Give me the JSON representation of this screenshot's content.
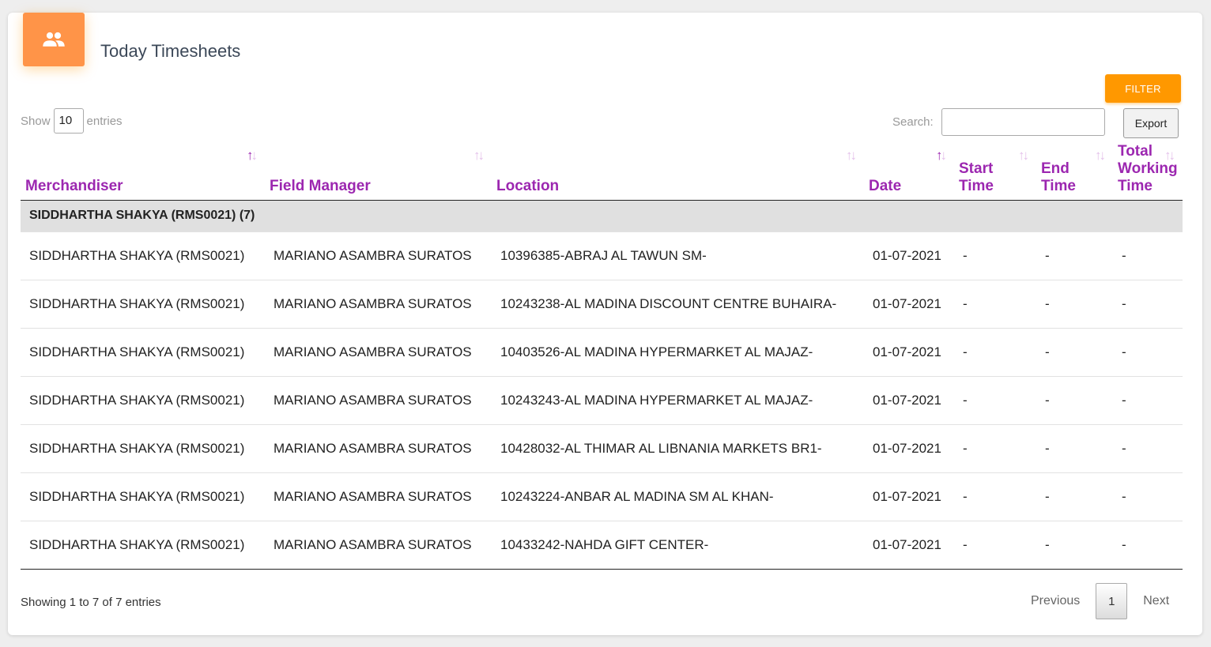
{
  "header": {
    "title": "Today Timesheets",
    "icon": "people-icon",
    "icon_color": "#ff9448"
  },
  "toolbar": {
    "filter_label": "FILTER",
    "show_label": "Show",
    "entries_count": "10",
    "entries_label": "entries",
    "search_label": "Search:",
    "search_value": "",
    "export_label": "Export"
  },
  "colors": {
    "accent": "#9c27b0",
    "filter": "#ff9800"
  },
  "table": {
    "columns": [
      {
        "label": "Merchandiser",
        "sort": "asc"
      },
      {
        "label": "Field Manager",
        "sort": "none"
      },
      {
        "label": "Location",
        "sort": "none"
      },
      {
        "label": "Date",
        "sort": "asc"
      },
      {
        "label": "Start Time",
        "sort": "none"
      },
      {
        "label": "End Time",
        "sort": "none"
      },
      {
        "label": "Total Working Time",
        "sort": "none"
      }
    ],
    "group_label": "SIDDHARTHA SHAKYA (RMS0021) (7)",
    "rows": [
      [
        "SIDDHARTHA SHAKYA (RMS0021)",
        "MARIANO ASAMBRA SURATOS",
        "10396385-ABRAJ AL TAWUN SM-",
        "01-07-2021",
        "-",
        "-",
        "-"
      ],
      [
        "SIDDHARTHA SHAKYA (RMS0021)",
        "MARIANO ASAMBRA SURATOS",
        "10243238-AL MADINA DISCOUNT CENTRE BUHAIRA-",
        "01-07-2021",
        "-",
        "-",
        "-"
      ],
      [
        "SIDDHARTHA SHAKYA (RMS0021)",
        "MARIANO ASAMBRA SURATOS",
        "10403526-AL MADINA HYPERMARKET AL MAJAZ-",
        "01-07-2021",
        "-",
        "-",
        "-"
      ],
      [
        "SIDDHARTHA SHAKYA (RMS0021)",
        "MARIANO ASAMBRA SURATOS",
        "10243243-AL MADINA HYPERMARKET AL MAJAZ-",
        "01-07-2021",
        "-",
        "-",
        "-"
      ],
      [
        "SIDDHARTHA SHAKYA (RMS0021)",
        "MARIANO ASAMBRA SURATOS",
        "10428032-AL THIMAR AL LIBNANIA MARKETS BR1-",
        "01-07-2021",
        "-",
        "-",
        "-"
      ],
      [
        "SIDDHARTHA SHAKYA (RMS0021)",
        "MARIANO ASAMBRA SURATOS",
        "10243224-ANBAR AL MADINA SM AL KHAN-",
        "01-07-2021",
        "-",
        "-",
        "-"
      ],
      [
        "SIDDHARTHA SHAKYA (RMS0021)",
        "MARIANO ASAMBRA SURATOS",
        "10433242-NAHDA GIFT CENTER-",
        "01-07-2021",
        "-",
        "-",
        "-"
      ]
    ]
  },
  "footer": {
    "info": "Showing 1 to 7 of 7 entries",
    "previous_label": "Previous",
    "current_page": "1",
    "next_label": "Next"
  }
}
